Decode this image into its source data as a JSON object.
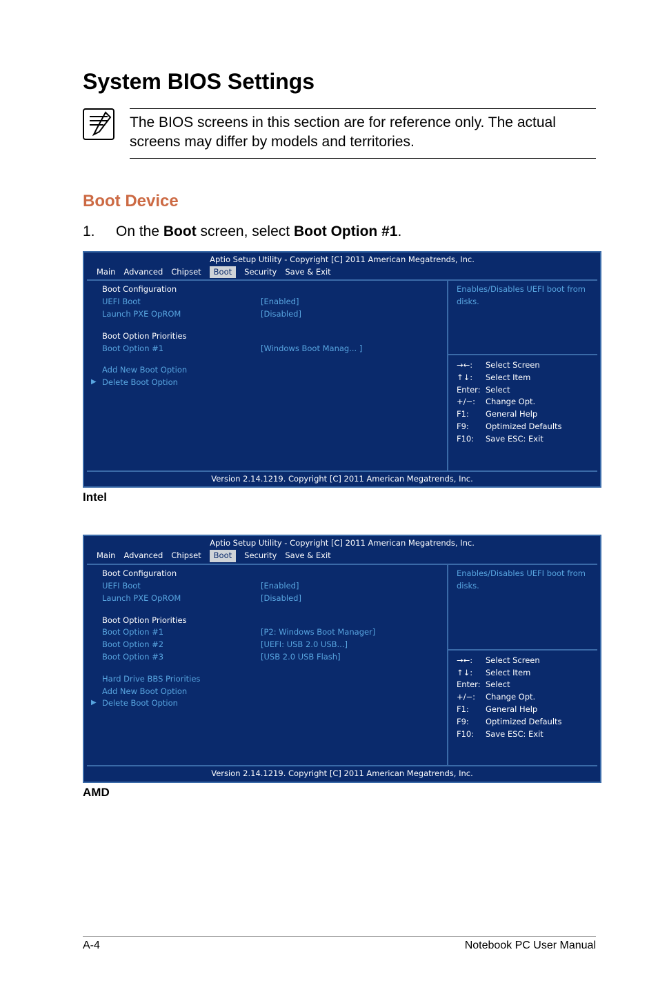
{
  "headings": {
    "h1": "System BIOS Settings",
    "boot_device": "Boot Device"
  },
  "note": "The BIOS screens in this section are for reference only. The actual screens may differ by models and territories.",
  "step1": {
    "num": "1.",
    "pre": "On the ",
    "bold1": "Boot",
    "mid": " screen, select ",
    "bold2": "Boot Option #1",
    "post": "."
  },
  "labels": {
    "intel": "Intel",
    "amd": "AMD"
  },
  "bios_common": {
    "title": "Aptio Setup Utility - Copyright [C] 2011 American Megatrends, Inc.",
    "tabs": {
      "main": "Main",
      "advanced": "Advanced",
      "chipset": "Chipset",
      "boot": "Boot",
      "security": "Security",
      "save_exit": "Save & Exit"
    },
    "footer": "Version 2.14.1219. Copyright [C] 2011 American Megatrends, Inc.",
    "desc_intel": "Enables/Disables UEFI boot from disks.",
    "desc_amd": "Enables/Disables UEFI boot from disks.",
    "help": {
      "arrows_lr": "→←:",
      "arrows_lr_v": "Select Screen",
      "arrows_ud": "↑↓:",
      "arrows_ud_v": "Select Item",
      "enter": "Enter:",
      "enter_v": "Select",
      "pm": "+/−:",
      "pm_v": "Change Opt.",
      "f1": "F1:",
      "f1_v": "General Help",
      "f9": "F9:",
      "f9_v": "Optimized Defaults",
      "f10": "F10:",
      "f10_v": "Save   ESC: Exit"
    }
  },
  "intel": {
    "boot_config": "Boot Configuration",
    "uefi_boot": "UEFI Boot",
    "uefi_boot_v": "[Enabled]",
    "launch_pxe": "Launch PXE OpROM",
    "launch_pxe_v": "[Disabled]",
    "priorities": "Boot Option Priorities",
    "opt1": "Boot Option #1",
    "opt1_v": "[Windows Boot Manag... ]",
    "add": "Add New Boot Option",
    "delete": "Delete Boot Option"
  },
  "amd": {
    "boot_config": "Boot Configuration",
    "uefi_boot": "UEFI Boot",
    "uefi_boot_v": "[Enabled]",
    "launch_pxe": "Launch PXE OpROM",
    "launch_pxe_v": "[Disabled]",
    "priorities": "Boot Option Priorities",
    "opt1": "Boot Option #1",
    "opt1_v": "[P2:  Windows Boot Manager]",
    "opt2": "Boot Option #2",
    "opt2_v": "[UEFI: USB 2.0 USB...]",
    "opt3": "Boot Option #3",
    "opt3_v": "[USB 2.0 USB Flash]",
    "hdd": "Hard Drive BBS Priorities",
    "add": "Add New Boot Option",
    "delete": "Delete Boot Option"
  },
  "page_footer": {
    "left": "A-4",
    "right": "Notebook PC User Manual"
  }
}
